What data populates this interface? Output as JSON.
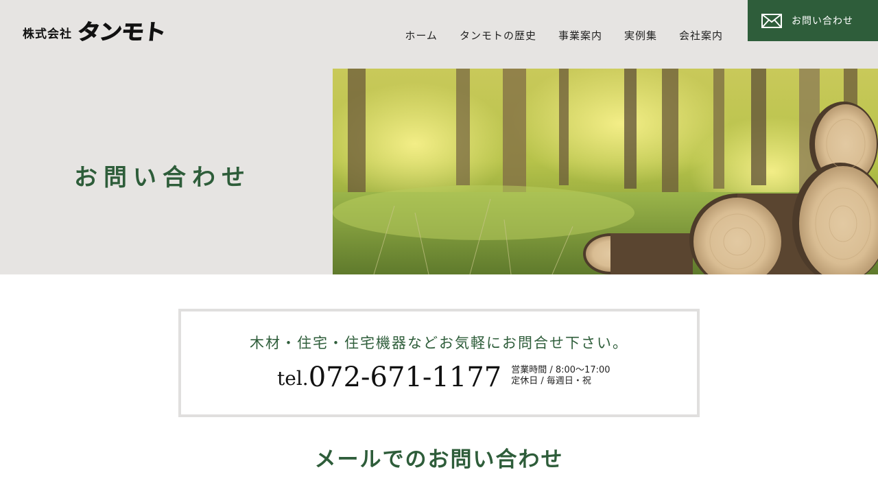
{
  "header": {
    "logo_prefix": "株式会社",
    "logo_name": "タンモト",
    "nav": [
      {
        "label": "ホーム"
      },
      {
        "label": "タンモトの歴史"
      },
      {
        "label": "事業案内"
      },
      {
        "label": "実例集"
      },
      {
        "label": "会社案内"
      }
    ],
    "contact_button": {
      "label": "お問い合わせ",
      "icon": "mail-icon"
    }
  },
  "hero": {
    "title": "お問い合わせ",
    "image": "forest-log-photo"
  },
  "info_box": {
    "lead": "木材・住宅・住宅機器などお気軽にお問合せ下さい。",
    "tel_prefix": "tel.",
    "tel_number": "072-671-1177",
    "hours": "営業時間 / 8:00～17:00",
    "holidays": "定休日 / 毎週日・祝"
  },
  "mail_section": {
    "heading": "メールでのお問い合わせ"
  },
  "colors": {
    "brand_green": "#2e5d3a",
    "header_bg": "#e6e4e2",
    "box_border": "#e0dfde"
  }
}
